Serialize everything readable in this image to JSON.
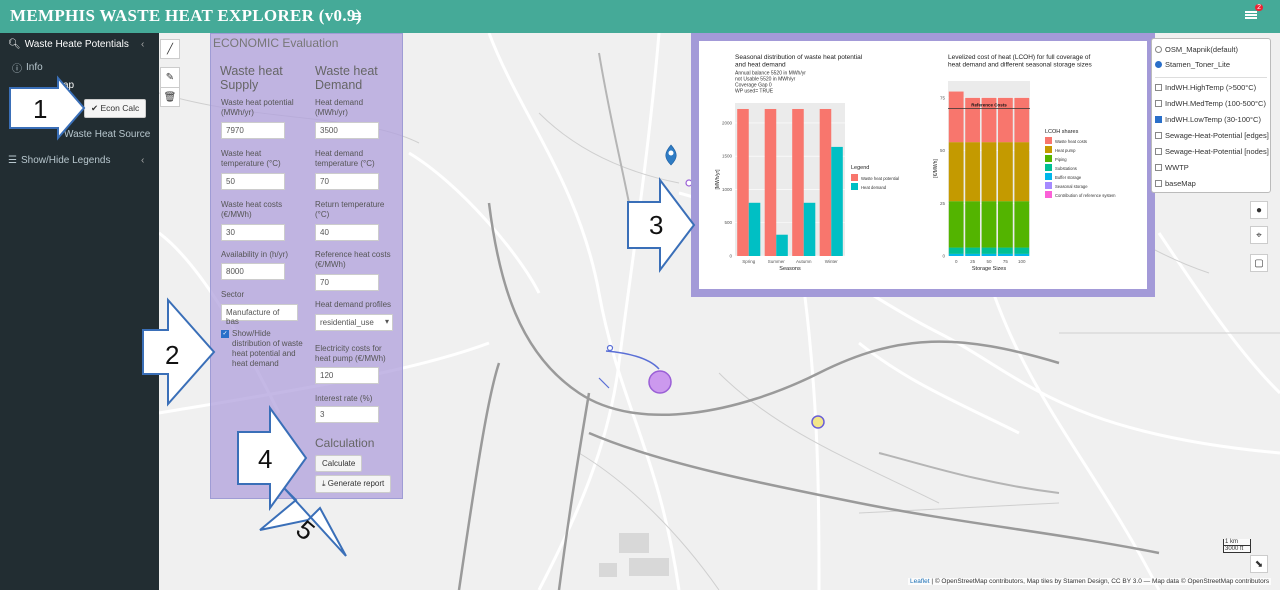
{
  "header": {
    "title": "MEMPHIS WASTE HEAT EXPLORER (v0.9)",
    "menu_icon": "hamburger-icon",
    "notif_count": "2"
  },
  "sidebar": {
    "items": [
      {
        "label": "Waste Heate Potentials",
        "icon": "search-icon"
      },
      {
        "label": "Info"
      },
      {
        "label": "ap"
      },
      {
        "label": "Waste Heat Source"
      },
      {
        "label": "Show/Hide Legends",
        "icon": "list-icon"
      }
    ],
    "econ_button": "Econ Calc"
  },
  "panel": {
    "title": "ECONOMIC Evaluation",
    "supply_head_1": "Waste heat",
    "supply_head_2": "Supply",
    "demand_head_1": "Waste heat",
    "demand_head_2": "Demand",
    "supply_fields": [
      {
        "label1": "Waste heat potential",
        "label2": "(MWh/yr)",
        "value": "7970"
      },
      {
        "label1": "Waste heat",
        "label2": "temperature (°C)",
        "value": "50"
      },
      {
        "label1": "Waste heat costs",
        "label2": "(€/MWh)",
        "value": "30"
      },
      {
        "label1": "Availability in (h/yr)",
        "label2": "",
        "value": "8000"
      },
      {
        "label1": "Sector",
        "label2": "",
        "value": "Manufacture of bas"
      }
    ],
    "demand_fields": [
      {
        "label1": "Heat demand",
        "label2": "(MWh/yr)",
        "value": "3500"
      },
      {
        "label1": "Heat demand",
        "label2": "temperature (°C)",
        "value": "70"
      },
      {
        "label1": "Return temperature",
        "label2": "(°C)",
        "value": "40"
      },
      {
        "label1": "Reference heat costs",
        "label2": "(€/MWh)",
        "value": "70"
      },
      {
        "label1": "Heat demand profiles",
        "label2": "",
        "value": "residential_use"
      },
      {
        "label1": "Electricity costs for",
        "label2": "heat pump (€/MWh)",
        "value": "120"
      },
      {
        "label1": "Interest rate (%)",
        "label2": "",
        "value": "3"
      }
    ],
    "checkbox_label": [
      "Show/Hide",
      "distribution of waste",
      "heat potential and",
      "heat demand"
    ],
    "calc_head": "Calculation",
    "calc_button": "Calculate",
    "report_button": "Generate report"
  },
  "layers": {
    "base": [
      {
        "label": "OSM_Mapnik(default)",
        "checked": false
      },
      {
        "label": "Stamen_Toner_Lite",
        "checked": true
      }
    ],
    "overlays": [
      {
        "label": "IndWH.HighTemp (>500°C)",
        "checked": false
      },
      {
        "label": "IndWH.MedTemp (100-500°C)",
        "checked": false
      },
      {
        "label": "IndWH.LowTemp (30-100°C)",
        "checked": true
      },
      {
        "label": "Sewage-Heat-Potential [edges]",
        "checked": false
      },
      {
        "label": "Sewage-Heat-Potential [nodes]",
        "checked": false
      },
      {
        "label": "WWTP",
        "checked": false
      },
      {
        "label": "baseMap",
        "checked": false
      }
    ]
  },
  "chart_data": [
    {
      "type": "bar",
      "title": "Seasonal distribution of waste heat potential and heat demand",
      "subtitle": [
        "Annual balance 5520 in MWh/yr",
        "not Usable 5520 in MWh/yr",
        "Coverage Gap 0",
        "WP used= TRUE"
      ],
      "categories": [
        "Spring",
        "Summer",
        "Autumn",
        "Winter"
      ],
      "series": [
        {
          "name": "Waste heat potential",
          "values": [
            2210,
            2210,
            2210,
            2210
          ],
          "color": "#f8766d"
        },
        {
          "name": "Heat demand",
          "values": [
            800,
            320,
            800,
            1640
          ],
          "color": "#00bfc4"
        }
      ],
      "xlabel": "Seasons",
      "ylabel": "[MWh/yr]",
      "yticks": [
        "0",
        "500",
        "1000",
        "1500",
        "2000"
      ],
      "ylim": [
        0,
        2300
      ],
      "legend_title": "Legend"
    },
    {
      "type": "bar",
      "title": "Levelized cost of heat (LCOH) for full coverage of heat demand and different seasonal storage sizes",
      "categories": [
        "0",
        "25",
        "50",
        "75",
        "100"
      ],
      "series": [
        {
          "name": "Waste heat costs",
          "values": [
            0,
            0,
            0,
            0,
            0
          ],
          "color": "#f8766d"
        },
        {
          "name": "Heat pump",
          "values": [
            28,
            28,
            28,
            28,
            28
          ],
          "color": "#c49a00"
        },
        {
          "name": "Piping",
          "values": [
            22,
            22,
            22,
            22,
            22
          ],
          "color": "#53b400"
        },
        {
          "name": "Substations",
          "values": [
            3,
            3,
            3,
            3,
            3
          ],
          "color": "#00c094"
        },
        {
          "name": "Buffer storage",
          "values": [
            1,
            1,
            1,
            1,
            1
          ],
          "color": "#00b6eb"
        },
        {
          "name": "Seasonal storage",
          "values": [
            0,
            0,
            0,
            0,
            0
          ],
          "color": "#a58aff"
        },
        {
          "name": "Contribution of reference system",
          "values": [
            24,
            21,
            21,
            21,
            21
          ],
          "color": "#fb61d7"
        }
      ],
      "reference_label": "Reference Costs",
      "reference_value": 70,
      "xlabel": "Storage Sizes",
      "ylabel": "[€/MWh]",
      "yticks": [
        "0",
        "25",
        "50",
        "75"
      ],
      "ylim": [
        0,
        83
      ],
      "legend_title": "LCOH shares"
    }
  ],
  "callouts": [
    "1",
    "2",
    "3",
    "4",
    "5"
  ],
  "map": {
    "attribution_leaflet": "Leaflet",
    "attribution_text": "| © OpenStreetMap contributors, Map tiles by Stamen Design, CC BY 3.0 — Map data © OpenStreetMap contributors",
    "scale_km": "1 km",
    "scale_ft": "3000 ft"
  }
}
